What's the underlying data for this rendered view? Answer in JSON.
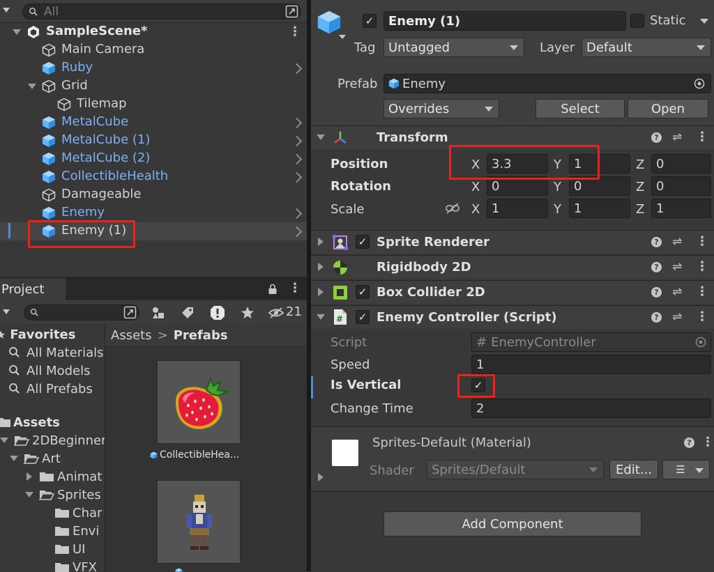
{
  "hierarchy": {
    "search_placeholder": "All",
    "scene_name": "SampleScene*",
    "items": [
      {
        "label": "Main Camera",
        "kind": "gameobject"
      },
      {
        "label": "Ruby",
        "kind": "prefab"
      },
      {
        "label": "Grid",
        "kind": "gameobject"
      },
      {
        "label": "Tilemap",
        "kind": "gameobject"
      },
      {
        "label": "MetalCube",
        "kind": "prefab"
      },
      {
        "label": "MetalCube (1)",
        "kind": "prefab"
      },
      {
        "label": "MetalCube (2)",
        "kind": "prefab"
      },
      {
        "label": "CollectibleHealth",
        "kind": "prefab"
      },
      {
        "label": "Damageable",
        "kind": "gameobject"
      },
      {
        "label": "Enemy",
        "kind": "prefab"
      },
      {
        "label": "Enemy (1)",
        "kind": "prefab",
        "selected": true
      }
    ]
  },
  "project": {
    "tab_label": "Project",
    "hidden_count": "21",
    "favorites": {
      "label": "Favorites",
      "items": [
        "All Materials",
        "All Models",
        "All Prefabs"
      ]
    },
    "assets": {
      "label": "Assets",
      "tree": [
        "2DBeginner",
        "Art",
        "Animat",
        "Sprites",
        "Char",
        "Envi",
        "UI",
        "VFX"
      ]
    },
    "breadcrumb": [
      "Assets",
      "Prefabs"
    ],
    "grid_items": [
      {
        "label": "CollectibleHea...",
        "icon": "strawberry-icon"
      },
      {
        "label": "",
        "icon": "enemy-robot-icon"
      }
    ]
  },
  "inspector": {
    "object_name": "Enemy (1)",
    "active": true,
    "static_label": "Static",
    "tag_label": "Tag",
    "tag_value": "Untagged",
    "layer_label": "Layer",
    "layer_value": "Default",
    "prefab_label": "Prefab",
    "prefab_value": "Enemy",
    "overrides_label": "Overrides",
    "select_label": "Select",
    "open_label": "Open",
    "transform": {
      "title": "Transform",
      "position": {
        "label": "Position",
        "x": "3.3",
        "y": "1",
        "z": "0"
      },
      "rotation": {
        "label": "Rotation",
        "x": "0",
        "y": "0",
        "z": "0"
      },
      "scale": {
        "label": "Scale",
        "x": "1",
        "y": "1",
        "z": "1"
      },
      "axis_x": "X",
      "axis_y": "Y",
      "axis_z": "Z"
    },
    "components": [
      {
        "title": "Sprite Renderer",
        "enabled": true
      },
      {
        "title": "Rigidbody 2D"
      },
      {
        "title": "Box Collider 2D",
        "enabled": true
      },
      {
        "title": "Enemy Controller (Script)",
        "enabled": true
      }
    ],
    "script": {
      "script_label": "Script",
      "script_value": "EnemyController",
      "speed_label": "Speed",
      "speed_value": "1",
      "vertical_label": "Is Vertical",
      "vertical_value": true,
      "change_label": "Change Time",
      "change_value": "2"
    },
    "material": {
      "name": "Sprites-Default (Material)",
      "shader_label": "Shader",
      "shader_value": "Sprites/Default",
      "edit_label": "Edit..."
    },
    "add_component_label": "Add Component"
  },
  "colors": {
    "highlight": "#e8231c",
    "prefab_blue": "#7bb0f2",
    "background": "#383838"
  }
}
